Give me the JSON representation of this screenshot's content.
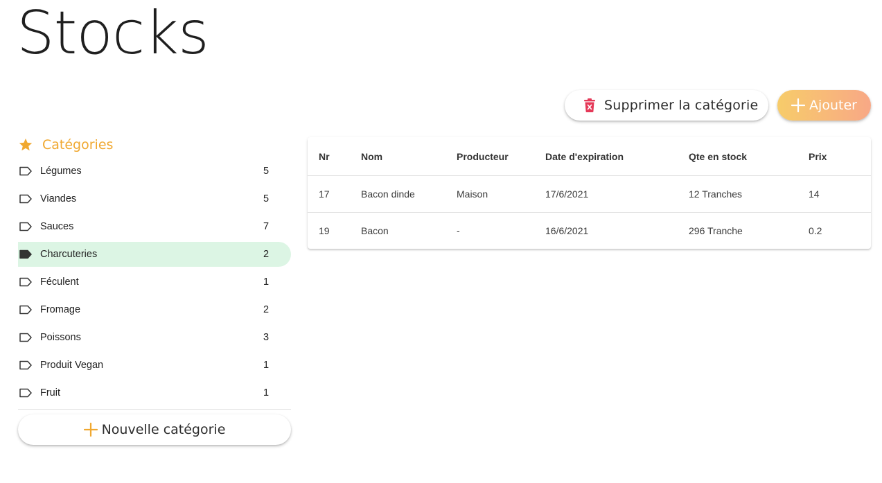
{
  "page": {
    "title": "Stocks"
  },
  "actions": {
    "delete_category_label": "Supprimer la catégorie",
    "add_label": "Ajouter"
  },
  "sidebar": {
    "header": "Catégories",
    "items": [
      {
        "label": "Légumes",
        "count": "5",
        "active": false
      },
      {
        "label": "Viandes",
        "count": "5",
        "active": false
      },
      {
        "label": "Sauces",
        "count": "7",
        "active": false
      },
      {
        "label": "Charcuteries",
        "count": "2",
        "active": true
      },
      {
        "label": "Féculent",
        "count": "1",
        "active": false
      },
      {
        "label": "Fromage",
        "count": "2",
        "active": false
      },
      {
        "label": "Poissons",
        "count": "3",
        "active": false
      },
      {
        "label": "Produit Vegan",
        "count": "1",
        "active": false
      },
      {
        "label": "Fruit",
        "count": "1",
        "active": false
      }
    ],
    "new_category_label": "Nouvelle catégorie"
  },
  "table": {
    "columns": [
      "Nr",
      "Nom",
      "Producteur",
      "Date d'expiration",
      "Qte en stock",
      "Prix"
    ],
    "rows": [
      [
        "17",
        "Bacon dinde",
        "Maison",
        "17/6/2021",
        "12 Tranches",
        "14"
      ],
      [
        "19",
        "Bacon",
        "-",
        "16/6/2021",
        "296 Tranche",
        "0.2"
      ]
    ]
  },
  "colors": {
    "accent_orange": "#f0a830",
    "active_row_bg": "#dcf5e4",
    "add_gradient_start": "#f7cc6a",
    "add_gradient_end": "#f8a886",
    "delete_icon": "#e53958"
  },
  "icons": {
    "delete": "trash-icon",
    "add": "plus-icon",
    "header": "star-icon",
    "category": "label-outline-icon",
    "category_active": "label-filled-icon"
  }
}
